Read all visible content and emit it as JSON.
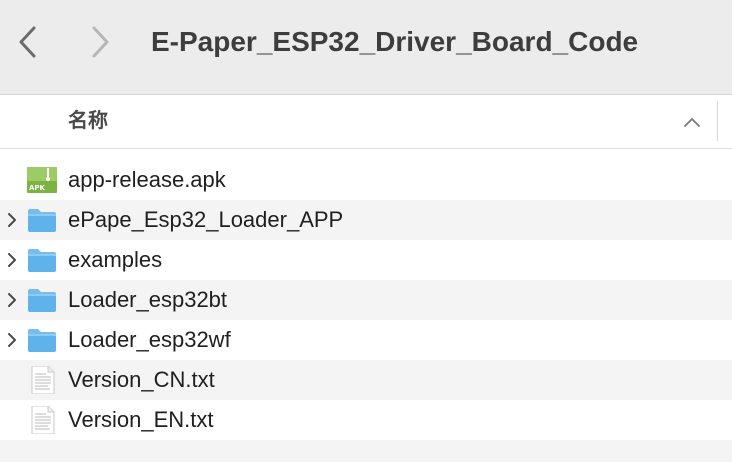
{
  "toolbar": {
    "back_icon": "chevron-left-icon",
    "forward_icon": "chevron-right-icon",
    "title": "E-Paper_ESP32_Driver_Board_Code"
  },
  "columns": {
    "name_header": "名称",
    "sort_icon": "chevron-up-icon"
  },
  "files": [
    {
      "name": "app-release.apk",
      "kind": "apk",
      "icon": "apk-file-icon",
      "expandable": false
    },
    {
      "name": "ePape_Esp32_Loader_APP",
      "kind": "folder",
      "icon": "folder-icon",
      "expandable": true
    },
    {
      "name": "examples",
      "kind": "folder",
      "icon": "folder-icon",
      "expandable": true
    },
    {
      "name": "Loader_esp32bt",
      "kind": "folder",
      "icon": "folder-icon",
      "expandable": true
    },
    {
      "name": "Loader_esp32wf",
      "kind": "folder",
      "icon": "folder-icon",
      "expandable": true
    },
    {
      "name": "Version_CN.txt",
      "kind": "text",
      "icon": "text-file-icon",
      "expandable": false
    },
    {
      "name": "Version_EN.txt",
      "kind": "text",
      "icon": "text-file-icon",
      "expandable": false
    }
  ],
  "icon_labels": {
    "apk": "APK"
  },
  "colors": {
    "folder": "#5fb2ea",
    "apk": "#7cb342",
    "toolbar_bg": "#ececec",
    "alt_row": "#f4f4f4"
  }
}
